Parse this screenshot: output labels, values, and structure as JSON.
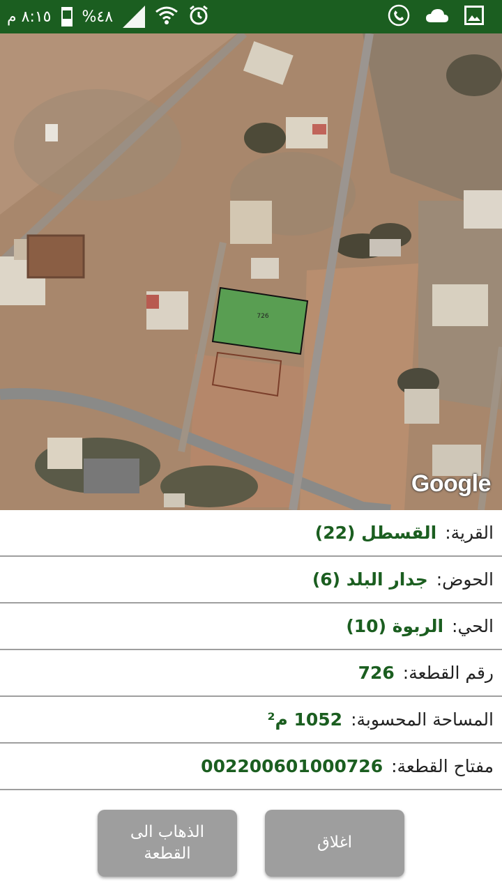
{
  "status_bar": {
    "time": "٨:١٥ م",
    "battery": "%٤٨",
    "icons": [
      "battery-icon",
      "signal-icon",
      "wifi-icon",
      "alarm-icon",
      "phone-call-icon",
      "cloud-icon",
      "image-icon"
    ]
  },
  "map": {
    "parcel_label": "726",
    "attribution": "Google",
    "colors": {
      "parcel_fill": "#3fa64a",
      "ground": "#a8876c",
      "road": "#8a8a88"
    }
  },
  "info": {
    "rows": [
      {
        "label": "القرية:",
        "value": "القسطل (22)"
      },
      {
        "label": "الحوض:",
        "value": "جدار البلد (6)"
      },
      {
        "label": "الحي:",
        "value": "الربوة (10)"
      },
      {
        "label": "رقم القطعة:",
        "value": "726"
      },
      {
        "label": "المساحة المحسوبة:",
        "value": "1052 م²"
      },
      {
        "label": "مفتاح القطعة:",
        "value": "002200601000726"
      }
    ]
  },
  "buttons": {
    "close": "اغلاق",
    "goto": "الذهاب الى\nالقطعة"
  },
  "colors": {
    "brand": "#1b5e20",
    "value_text": "#1b5e20",
    "button": "#9e9e9e"
  }
}
